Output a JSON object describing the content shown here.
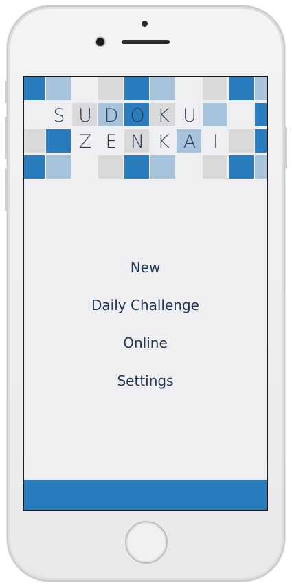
{
  "app": {
    "title_row1": [
      "S",
      "U",
      "D",
      "O",
      "K",
      "U"
    ],
    "title_row2": [
      "Z",
      "E",
      "N",
      "K",
      "A",
      "I"
    ]
  },
  "menu": {
    "items": [
      {
        "label": "New"
      },
      {
        "label": "Daily Challenge"
      },
      {
        "label": "Online"
      },
      {
        "label": "Settings"
      }
    ]
  },
  "colors": {
    "accent": "#2b7cbc",
    "light_blue": "#a8c4dc",
    "gray": "#d9d9db",
    "text": "#1f3657"
  }
}
